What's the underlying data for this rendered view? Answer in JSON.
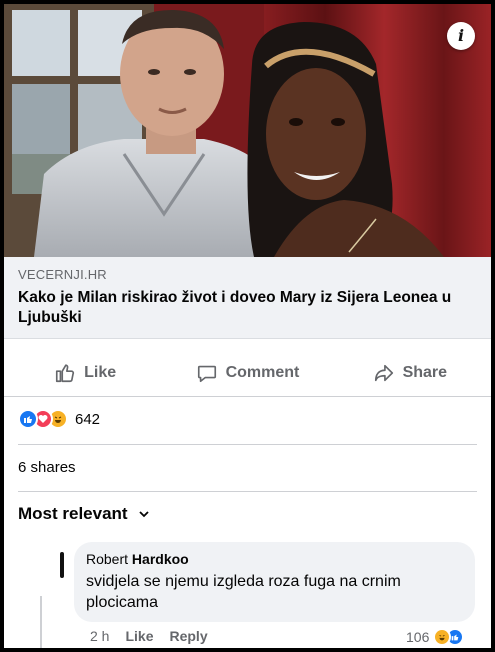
{
  "info_glyph": "i",
  "link": {
    "domain": "VECERNJI.HR",
    "headline": "Kako je Milan riskirao život i doveo Mary iz Sijera Leonea u Ljubuški"
  },
  "actions": {
    "like": "Like",
    "comment": "Comment",
    "share": "Share"
  },
  "reactions": {
    "icons": [
      "like-icon",
      "love-icon",
      "haha-icon"
    ],
    "count": "642"
  },
  "shares": "6 shares",
  "sort": {
    "label": "Most relevant"
  },
  "comment": {
    "author_first": "Robert ",
    "author_last": "Hardkoo",
    "text": "svidjela se njemu izgleda roza fuga na crnim plocicama",
    "time": "2 h",
    "like": "Like",
    "reply": "Reply",
    "reaction_count": "106",
    "reaction_icons": [
      "haha-icon",
      "like-icon"
    ]
  },
  "colors": {
    "facebook_blue": "#1877f2",
    "love_red": "#f33e58",
    "haha_yellow": "#f7b125",
    "secondary_text": "#65676b"
  }
}
